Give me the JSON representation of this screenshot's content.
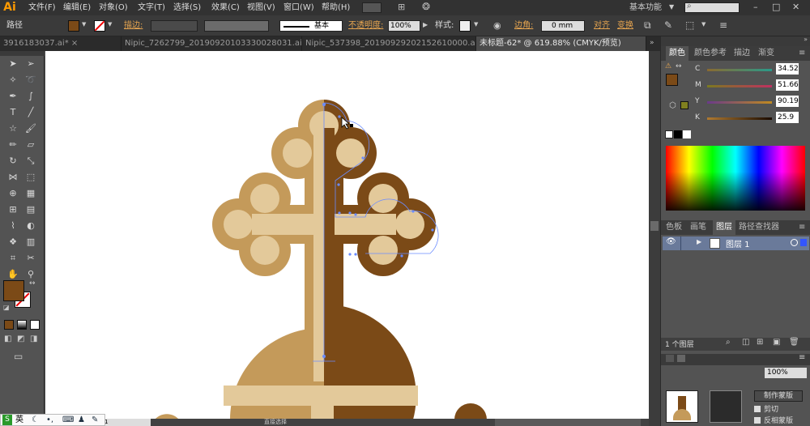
{
  "app": {
    "logo": "Ai"
  },
  "menu": [
    "文件(F)",
    "编辑(E)",
    "对象(O)",
    "文字(T)",
    "选择(S)",
    "效果(C)",
    "视图(V)",
    "窗口(W)",
    "帮助(H)"
  ],
  "workspace": {
    "label": "基本功能",
    "search_placeholder": ""
  },
  "control": {
    "selection_label": "路径",
    "stroke_label": "描边:",
    "brush_label": "基本",
    "opacity_label": "不透明度:",
    "opacity_value": "100%",
    "style_label": "样式:",
    "corner_label": "边角:",
    "corner_value": "0 mm",
    "align_label": "对齐",
    "transform_label": "变换"
  },
  "doc_tabs": [
    {
      "label": "3916183037.ai* ×",
      "active": false
    },
    {
      "label": "Nipic_7262799_20190920103330028031.ai* ×",
      "active": false
    },
    {
      "label": "Nipic_537398_20190929202152610000.ai* ×",
      "active": false
    },
    {
      "label": "未标题-62* @ 619.88% (CMYK/预览)",
      "active": true
    }
  ],
  "color_panel": {
    "tabs": [
      "颜色",
      "颜色参考",
      "描边",
      "渐变"
    ],
    "channels": [
      {
        "name": "C",
        "value": "34.52"
      },
      {
        "name": "M",
        "value": "51.66"
      },
      {
        "name": "Y",
        "value": "90.19"
      },
      {
        "name": "K",
        "value": "25.9"
      }
    ],
    "fill_color": "#7b4a17"
  },
  "layers_panel": {
    "tabs": [
      "色板",
      "画笔",
      "图层",
      "路径查找器"
    ],
    "layers": [
      {
        "name": "图层 1"
      }
    ],
    "footer_count": "1 个图层"
  },
  "lower_panel": {
    "opacity_value": "100%",
    "make_mask": "制作蒙版",
    "clip_label": "剪切",
    "invert_label": "反相蒙版"
  },
  "status_bar": {
    "zoom": "1",
    "mode": "直接选择"
  },
  "ime": {
    "label": "英"
  },
  "colors": {
    "dark_brown": "#7b4a17",
    "mid_tan": "#c49a5a",
    "light_tan": "#e3c99a"
  }
}
